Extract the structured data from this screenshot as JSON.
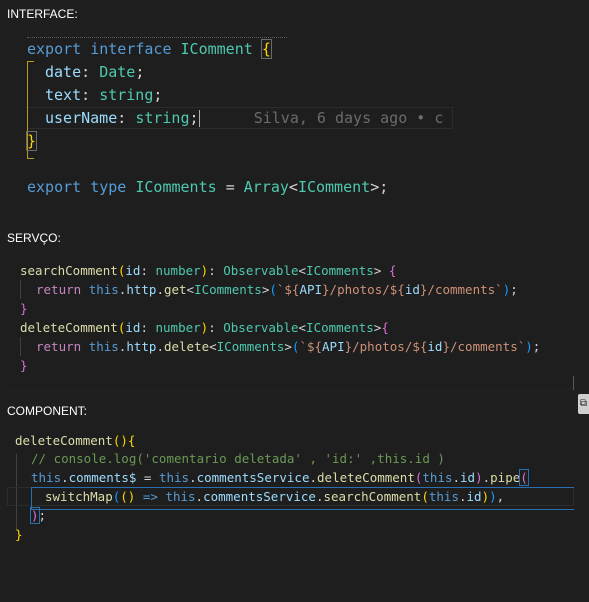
{
  "sections": {
    "interface_label": "INTERFACE:",
    "service_label": "SERVÇO:",
    "component_label": "COMPONENT:"
  },
  "colors": {
    "keyword": "#569cd6",
    "control": "#c586c0",
    "type": "#4ec9b0",
    "property": "#9cdcfe",
    "function": "#dcdcaa",
    "string": "#ce9178",
    "comment": "#6a9955",
    "bracket_gold": "#ffd700",
    "bracket_magenta": "#da70d6",
    "bracket_blue": "#179fff",
    "editor_bg": "#1e1e1e"
  },
  "interface_code": {
    "l1": {
      "a": "export",
      "b": "interface",
      "c": "IComment",
      "d": "{"
    },
    "l2": {
      "a": "date",
      "b": ":",
      "c": "Date",
      "d": ";"
    },
    "l3": {
      "a": "text",
      "b": ":",
      "c": "string",
      "d": ";"
    },
    "l4": {
      "a": "userName",
      "b": ":",
      "c": "string",
      "d": ";",
      "blame": "Silva, 6 days ago • c"
    },
    "l5": {
      "a": "}"
    },
    "l7": {
      "a": "export",
      "b": "type",
      "c": "IComments",
      "d": "=",
      "e": "Array",
      "f": "<",
      "g": "IComment",
      "h": ">",
      "i": ";"
    }
  },
  "service_code": {
    "l1": {
      "a": "searchComment",
      "b": "(",
      "c": "id",
      "d": ": ",
      "e": "number",
      "f": ")",
      "g": ": ",
      "h": "Observable",
      "i": "<",
      "j": "IComments",
      "k": ">",
      "l": "{"
    },
    "l2": {
      "a": "return",
      "b": "this",
      "c": ".",
      "d": "http",
      "e": ".",
      "f": "get",
      "g": "<",
      "h": "IComments",
      "i": ">",
      "j": "(",
      "k": "`${",
      "m": "API",
      "n": "}/photos/${",
      "o": "id",
      "p": "}/comments`",
      "q": ")",
      "r": ";"
    },
    "l3": {
      "a": "}"
    },
    "l4": {
      "a": "deleteComment",
      "b": "(",
      "c": "id",
      "d": ": ",
      "e": "number",
      "f": ")",
      "g": ": ",
      "h": "Observable",
      "i": "<",
      "j": "IComments",
      "k": ">",
      "l": "{"
    },
    "l5": {
      "a": "return",
      "b": "this",
      "c": ".",
      "d": "http",
      "e": ".",
      "f": "delete",
      "g": "<",
      "h": "IComments",
      "i": ">",
      "j": "(",
      "k": "`${",
      "m": "API",
      "n": "}/photos/${",
      "o": "id",
      "p": "}/comments`",
      "q": ")",
      "r": ";"
    },
    "l6": {
      "a": "}"
    }
  },
  "component_code": {
    "l1": {
      "a": "deleteComment",
      "b": "()",
      "c": "{"
    },
    "l2": {
      "a": "// console.log('comentario deletada' , 'id:' ,this.id )"
    },
    "l3": {
      "a": "this",
      "b": ".",
      "c": "comments$",
      "d": " = ",
      "e": "this",
      "f": ".",
      "g": "commentsService",
      "h": ".",
      "i": "deleteComment",
      "j": "(",
      "k": "this",
      "l": ".",
      "m": "id",
      "n": ")",
      "o": ".",
      "p": "pipe",
      "q": "("
    },
    "l4": {
      "a": "switchMap",
      "b": "(",
      "c": "()",
      "d": " => ",
      "e": "this",
      "f": ".",
      "g": "commentsService",
      "h": ".",
      "i": "searchComment",
      "j": "(",
      "k": "this",
      "l": ".",
      "m": "id",
      "n": ")",
      "o": ")",
      "p": ","
    },
    "l5": {
      "a": ")",
      "b": ";"
    },
    "l6": {
      "a": "}"
    }
  },
  "side_icon": "copy-icon"
}
